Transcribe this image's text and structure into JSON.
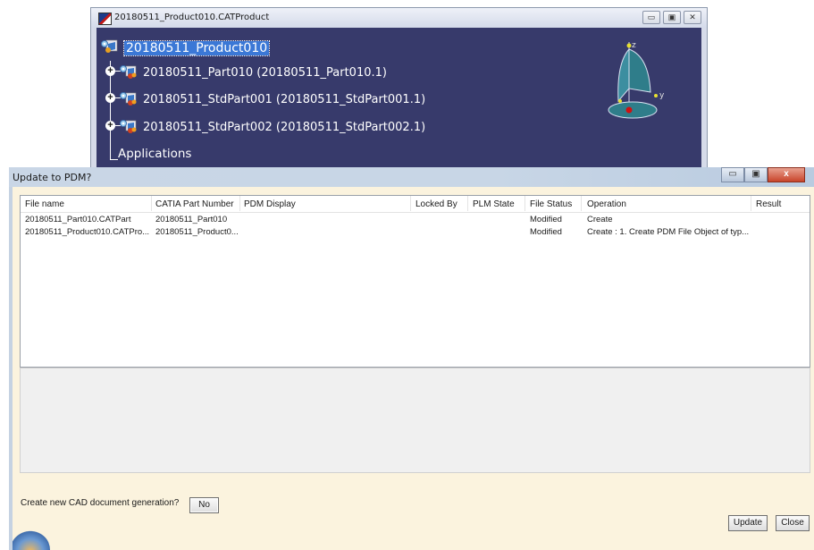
{
  "catia_window": {
    "title": "20180511_Product010.CATProduct",
    "controls": [
      "▭",
      "▣",
      "✕"
    ],
    "tree": {
      "root": "20180511_Product010",
      "children": [
        "20180511_Part010 (20180511_Part010.1)",
        "20180511_StdPart001 (20180511_StdPart001.1)",
        "20180511_StdPart002 (20180511_StdPart002.1)"
      ],
      "applications": "Applications"
    },
    "compass": {
      "z_label": "z",
      "y_label": "y"
    }
  },
  "dialog": {
    "title": "Update to PDM?",
    "controls": [
      "▭",
      "▣",
      "x"
    ],
    "columns": [
      "File name",
      "CATIA Part Number",
      "PDM Display",
      "Locked By",
      "PLM State",
      "File Status",
      "Operation",
      "Result"
    ],
    "rows": [
      {
        "file_name": "20180511_Part010.CATPart",
        "part_number": "20180511_Part010",
        "pdm_display": "",
        "locked_by": "",
        "plm_state": "",
        "file_status": "Modified",
        "operation": "Create",
        "result": ""
      },
      {
        "file_name": "20180511_Product010.CATPro...",
        "part_number": "20180511_Product0...",
        "pdm_display": "",
        "locked_by": "",
        "plm_state": "",
        "file_status": "Modified",
        "operation": "Create : 1. Create PDM File Object of typ...",
        "result": ""
      }
    ],
    "generation_label": "Create new CAD document generation?",
    "generation_value": "No",
    "update_label": "Update",
    "close_label": "Close"
  }
}
